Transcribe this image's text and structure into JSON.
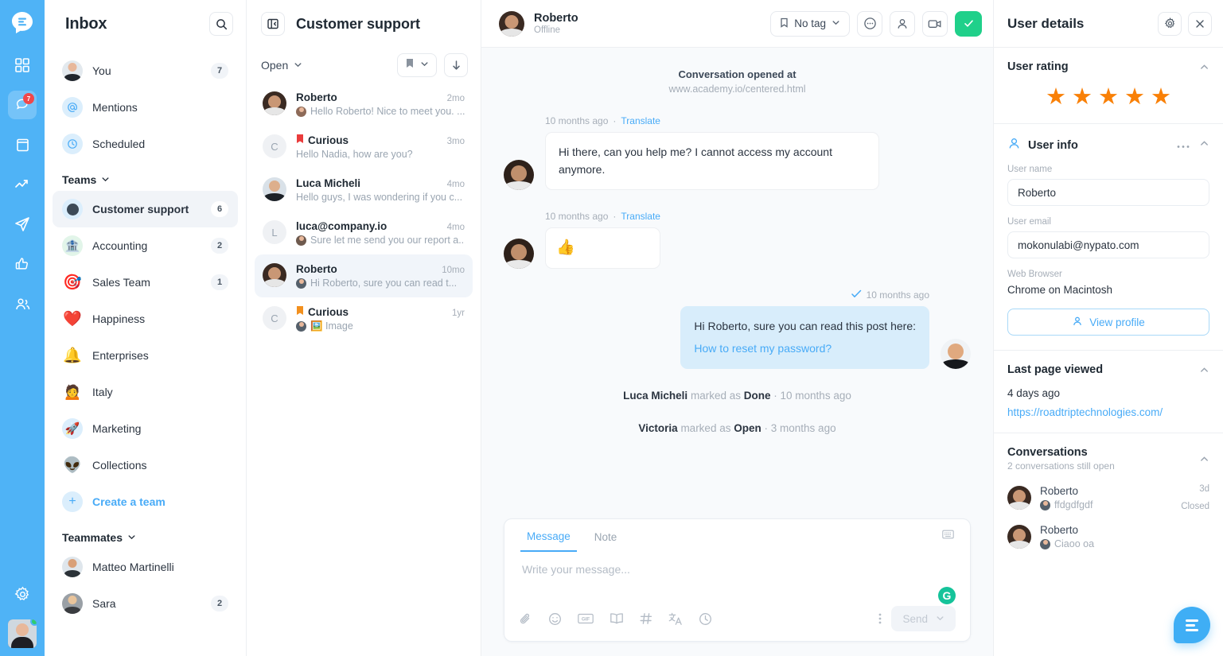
{
  "rail": {
    "logo_icon": "chat-logo-icon",
    "items": [
      {
        "icon": "grid-icon",
        "name": "apps",
        "active": false,
        "badge": ""
      },
      {
        "icon": "chat-bubbles-icon",
        "name": "conversations",
        "active": true,
        "badge": "7"
      },
      {
        "icon": "book-icon",
        "name": "knowledge-base",
        "active": false,
        "badge": ""
      },
      {
        "icon": "trending-up-icon",
        "name": "analytics",
        "active": false,
        "badge": ""
      },
      {
        "icon": "paper-plane-icon",
        "name": "campaigns",
        "active": false,
        "badge": ""
      },
      {
        "icon": "thumbs-up-icon",
        "name": "feedback",
        "active": false,
        "badge": ""
      },
      {
        "icon": "users-icon",
        "name": "contacts",
        "active": false,
        "badge": ""
      }
    ],
    "settings_icon": "gear-icon"
  },
  "inbox": {
    "title": "Inbox",
    "search_icon": "search-icon",
    "nav": [
      {
        "label": "You",
        "count": "7",
        "icon": "avatar",
        "selected": false
      },
      {
        "label": "Mentions",
        "count": "",
        "icon": "at-icon",
        "selected": false
      },
      {
        "label": "Scheduled",
        "count": "",
        "icon": "clock-icon",
        "selected": false
      }
    ],
    "teams_label": "Teams",
    "teams": [
      {
        "label": "Customer support",
        "count": "6",
        "emoji": "⚫",
        "selected": true
      },
      {
        "label": "Accounting",
        "count": "2",
        "emoji": "🏦",
        "selected": false
      },
      {
        "label": "Sales Team",
        "count": "1",
        "emoji": "🎯",
        "selected": false
      },
      {
        "label": "Happiness",
        "count": "",
        "emoji": "❤️",
        "selected": false
      },
      {
        "label": "Enterprises",
        "count": "",
        "emoji": "🔔",
        "selected": false
      },
      {
        "label": "Italy",
        "count": "",
        "emoji": "🙍",
        "selected": false
      },
      {
        "label": "Marketing",
        "count": "",
        "emoji": "🚀",
        "selected": false
      },
      {
        "label": "Collections",
        "count": "",
        "emoji": "👽",
        "selected": false
      }
    ],
    "create_team_label": "Create a team",
    "teammates_label": "Teammates",
    "teammates": [
      {
        "label": "Matteo Martinelli",
        "count": ""
      },
      {
        "label": "Sara",
        "count": "2"
      }
    ]
  },
  "conversation_list": {
    "panel_icon": "collapse-panel-icon",
    "title": "Customer support",
    "filter_label": "Open",
    "bookmark_icon": "bookmark-icon",
    "sort_icon": "sort-down-icon",
    "items": [
      {
        "name": "Roberto",
        "time": "2mo",
        "preview": "Hello Roberto! Nice to meet you. ...",
        "avatar": "photo-roberto",
        "letter": "",
        "flag": "",
        "selected": false,
        "has_mini": true
      },
      {
        "name": "Curious",
        "time": "3mo",
        "preview": "Hello Nadia, how are you?",
        "avatar": "letter",
        "letter": "C",
        "flag": "🔴",
        "selected": false,
        "has_mini": false
      },
      {
        "name": "Luca Micheli",
        "time": "4mo",
        "preview": "Hello guys, I was wondering if you c...",
        "avatar": "photo-luca",
        "letter": "",
        "flag": "",
        "selected": false,
        "has_mini": false
      },
      {
        "name": "luca@company.io",
        "time": "4mo",
        "preview": "Sure let me send you our report a...",
        "avatar": "letter",
        "letter": "L",
        "flag": "",
        "selected": false,
        "has_mini": true
      },
      {
        "name": "Roberto",
        "time": "10mo",
        "preview": "Hi Roberto, sure you can read t...",
        "avatar": "photo-roberto",
        "letter": "",
        "flag": "",
        "selected": true,
        "has_mini": true
      },
      {
        "name": "Curious",
        "time": "1yr",
        "preview": "🖼️ Image",
        "avatar": "letter",
        "letter": "C",
        "flag": "🟠",
        "selected": false,
        "has_mini": true
      }
    ]
  },
  "chat": {
    "header": {
      "name": "Roberto",
      "status": "Offline",
      "tag_label": "No tag",
      "tag_icon": "bookmark-icon",
      "chevron_icon": "chevron-down-icon",
      "more_icon": "more-circle-icon",
      "profile_icon": "person-icon",
      "video_icon": "video-camera-icon",
      "done_icon": "check-icon"
    },
    "opened_label": "Conversation opened at",
    "opened_url": "www.academy.io/centered.html",
    "messages": [
      {
        "direction": "in",
        "time": "10 months ago",
        "translate": "Translate",
        "text": "Hi there, can you help me? I cannot access my account anymore.",
        "emoji_only": false,
        "link": ""
      },
      {
        "direction": "in",
        "time": "10 months ago",
        "translate": "Translate",
        "text": "👍",
        "emoji_only": true,
        "link": ""
      },
      {
        "direction": "out",
        "time": "10 months ago",
        "translate": "",
        "text": "Hi Roberto, sure you can read this post here:",
        "emoji_only": false,
        "link": "How to reset my password?"
      }
    ],
    "events": [
      {
        "actor": "Luca Micheli",
        "action": "marked as",
        "state": "Done",
        "time": "10 months ago"
      },
      {
        "actor": "Victoria",
        "action": "marked as",
        "state": "Open",
        "time": "3 months ago"
      }
    ],
    "composer": {
      "tab_message": "Message",
      "tab_note": "Note",
      "placeholder": "Write your message...",
      "keyboard_icon": "keyboard-icon",
      "grammarly_badge": "G",
      "tools": [
        {
          "icon": "paperclip-icon",
          "glyph": "attach"
        },
        {
          "icon": "emoji-icon",
          "glyph": "emoji"
        },
        {
          "icon": "gif-icon",
          "glyph": "GIF"
        },
        {
          "icon": "saved-replies-icon",
          "glyph": "book"
        },
        {
          "icon": "hash-icon",
          "glyph": "#"
        },
        {
          "icon": "translate-icon",
          "glyph": "translate"
        },
        {
          "icon": "schedule-clock-icon",
          "glyph": "clock"
        }
      ],
      "more_icon": "more-vertical-icon",
      "send_label": "Send",
      "send_chevron_icon": "chevron-down-icon"
    }
  },
  "details": {
    "title": "User details",
    "gear_icon": "gear-icon",
    "close_icon": "close-icon",
    "rating": {
      "title": "User rating",
      "collapse_icon": "chevron-up-icon",
      "stars": 5,
      "star_glyph": "★",
      "star_color": "#F98007"
    },
    "user_info": {
      "title": "User info",
      "person_icon": "person-icon",
      "more_icon": "more-horizontal-icon",
      "collapse_icon": "chevron-up-icon",
      "name_label": "User name",
      "name_value": "Roberto",
      "email_label": "User email",
      "email_value": "mokonulabi@nypato.com",
      "browser_label": "Web Browser",
      "browser_value": "Chrome on Macintosh",
      "view_profile_label": "View profile",
      "view_profile_icon": "person-icon"
    },
    "last_page": {
      "title": "Last page viewed",
      "collapse_icon": "chevron-up-icon",
      "time": "4 days ago",
      "url": "https://roadtriptechnologies.com/"
    },
    "conversations": {
      "title": "Conversations",
      "collapse_icon": "chevron-up-icon",
      "subtitle": "2 conversations still open",
      "items": [
        {
          "name": "Roberto",
          "preview": "ffdgdfgdf",
          "time": "3d",
          "state": "Closed"
        },
        {
          "name": "Roberto",
          "preview": "Ciaoo oa",
          "time": "",
          "state": ""
        }
      ]
    },
    "fab_icon": "chat-logo-icon"
  }
}
